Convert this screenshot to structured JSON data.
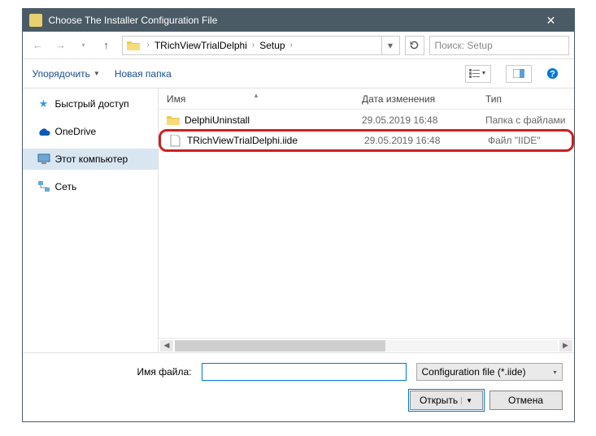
{
  "window": {
    "title": "Choose The Installer Configuration File"
  },
  "breadcrumb": {
    "items": [
      "TRichViewTrialDelphi",
      "Setup"
    ]
  },
  "search": {
    "placeholder": "Поиск: Setup"
  },
  "toolbar": {
    "organize": "Упорядочить",
    "new_folder": "Новая папка"
  },
  "sidebar": {
    "items": [
      {
        "label": "Быстрый доступ"
      },
      {
        "label": "OneDrive"
      },
      {
        "label": "Этот компьютер"
      },
      {
        "label": "Сеть"
      }
    ]
  },
  "columns": {
    "name": "Имя",
    "date": "Дата изменения",
    "type": "Тип"
  },
  "files": [
    {
      "name": "DelphiUninstall",
      "date": "29.05.2019 16:48",
      "type": "Папка с файлами",
      "kind": "folder"
    },
    {
      "name": "TRichViewTrialDelphi.iide",
      "date": "29.05.2019 16:48",
      "type": "Файл \"IIDE\"",
      "kind": "file"
    }
  ],
  "footer": {
    "filename_label": "Имя файла:",
    "filename_value": "",
    "filter": "Configuration file (*.iide)",
    "open": "Открыть",
    "cancel": "Отмена"
  }
}
